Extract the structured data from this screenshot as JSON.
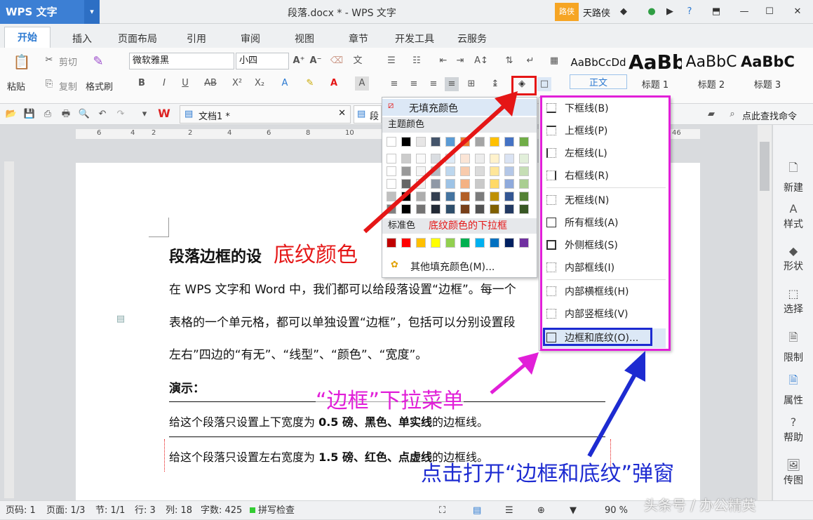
{
  "titlebar": {
    "app_name": "WPS 文字",
    "document_title": "段落.docx * - WPS 文字",
    "user_tag": "路侠",
    "user_name": "天路侠"
  },
  "tabs": [
    "开始",
    "插入",
    "页面布局",
    "引用",
    "审阅",
    "视图",
    "章节",
    "开发工具",
    "云服务"
  ],
  "ribbon": {
    "paste": "粘贴",
    "cut": "剪切",
    "copy": "复制",
    "format_painter": "格式刷",
    "font_name": "微软雅黑",
    "font_size": "小四",
    "styles": [
      {
        "preview": "AaBbCcDd",
        "name": "正文"
      },
      {
        "preview": "AaBb",
        "name": "标题 1"
      },
      {
        "preview": "AaBbC",
        "name": "标题 2"
      },
      {
        "preview": "AaBbC",
        "name": "标题 3"
      }
    ]
  },
  "quickbar": {
    "doc_tab_1": "文档1 *",
    "doc_tab_2": "段",
    "search_cmd": "点此查找命令"
  },
  "fill_menu": {
    "no_fill": "无填充颜色",
    "theme_colors": "主题颜色",
    "standard_colors": "标准色",
    "annotation_dropdown": "底纹颜色的下拉框",
    "more_colors": "其他填充颜色(M)...",
    "theme_top_row": [
      "#ffffff",
      "#000000",
      "#e7e6e6",
      "#44546a",
      "#5b9bd5",
      "#ed7d31",
      "#a5a5a5",
      "#ffc000",
      "#4472c4",
      "#70ad47"
    ],
    "standard_row": [
      "#c00000",
      "#ff0000",
      "#ffc000",
      "#ffff00",
      "#92d050",
      "#00b050",
      "#00b0f0",
      "#0070c0",
      "#002060",
      "#7030a0"
    ]
  },
  "border_menu": {
    "items": [
      "下框线(B)",
      "上框线(P)",
      "左框线(L)",
      "右框线(R)",
      "无框线(N)",
      "所有框线(A)",
      "外侧框线(S)",
      "内部框线(I)",
      "内部横框线(H)",
      "内部竖框线(V)",
      "边框和底纹(O)..."
    ]
  },
  "document": {
    "heading": "段落边框的设",
    "para1": "在 WPS 文字和 Word 中，我们都可以给段落设置“边框”。每一个",
    "para2": "表格的一个单元格，都可以单独设置“边框”，包括可以分别设置段",
    "para3": "左右”四边的“有无”、“线型”、“颜色”、“宽度”。",
    "demo_label": "演示：",
    "line1_pre": "给这个段落只设置上下宽度为 ",
    "line1_bold": "0.5 磅、黑色、单实线",
    "line1_post": "的边框线。",
    "line2_pre": "给这个段落只设置左右宽度为 ",
    "line2_bold": "1.5 磅、红色、点虚线",
    "line2_post": "的边框线。"
  },
  "annotations": {
    "shading_color": "底纹颜色",
    "border_dropdown": "“边框”下拉菜单",
    "click_open": "点击打开“边框和底纹”弹窗"
  },
  "sidepanel": [
    "新建",
    "样式",
    "形状",
    "选择",
    "限制",
    "属性",
    "帮助",
    "传图"
  ],
  "statusbar": {
    "page_no": "页码: 1",
    "pages": "页面: 1/3",
    "section": "节: 1/1",
    "row": "行: 3",
    "col": "列: 18",
    "words": "字数: 425",
    "spell": "拼写检查",
    "zoom": "90 %",
    "watermark": "头条号 / 办公精英"
  },
  "ruler_ticks": [
    "6",
    "4",
    "2",
    "2",
    "4",
    "6",
    "8",
    "10",
    "46"
  ],
  "colors": {
    "annotation_red": "#e51616",
    "annotation_magenta": "#e11fd8",
    "annotation_blue": "#1d2bd1",
    "accent_blue": "#2b79d1"
  }
}
